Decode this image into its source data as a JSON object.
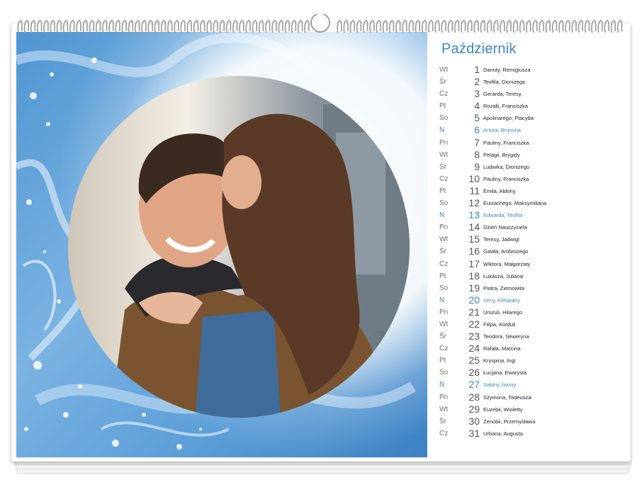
{
  "calendar": {
    "month": "Październik",
    "days": [
      {
        "dow": "Wt",
        "day": "1",
        "names": "Danuty, Remigiusza",
        "sunday": false
      },
      {
        "dow": "Śr",
        "day": "2",
        "names": "Teofila, Dionizego",
        "sunday": false
      },
      {
        "dow": "Cz",
        "day": "3",
        "names": "Gerarda, Teresy",
        "sunday": false
      },
      {
        "dow": "Pt",
        "day": "4",
        "names": "Rozalii, Franciszka",
        "sunday": false
      },
      {
        "dow": "So",
        "day": "5",
        "names": "Apolinarego, Placyda",
        "sunday": false
      },
      {
        "dow": "N",
        "day": "6",
        "names": "Artura, Brunona",
        "sunday": true
      },
      {
        "dow": "Pn",
        "day": "7",
        "names": "Pauliny, Franciszka",
        "sunday": false
      },
      {
        "dow": "Wt",
        "day": "8",
        "names": "Pelagii, Brygidy",
        "sunday": false
      },
      {
        "dow": "Śr",
        "day": "9",
        "names": "Ludwika, Dionizego",
        "sunday": false
      },
      {
        "dow": "Cz",
        "day": "10",
        "names": "Pauliny, Franciszka",
        "sunday": false
      },
      {
        "dow": "Pt",
        "day": "11",
        "names": "Emila, Aldony",
        "sunday": false
      },
      {
        "dow": "So",
        "day": "12",
        "names": "Eustachego, Maksymiliana",
        "sunday": false
      },
      {
        "dow": "N",
        "day": "13",
        "names": "Edwarda, Teofila",
        "sunday": true
      },
      {
        "dow": "Pn",
        "day": "14",
        "names": "Dzień Nauczyciela",
        "sunday": false
      },
      {
        "dow": "Wt",
        "day": "15",
        "names": "Teresy, Jadwigi",
        "sunday": false
      },
      {
        "dow": "Śr",
        "day": "16",
        "names": "Gawła, Ambrożego",
        "sunday": false
      },
      {
        "dow": "Cz",
        "day": "17",
        "names": "Wiktora, Małgorzaty",
        "sunday": false
      },
      {
        "dow": "Pt",
        "day": "18",
        "names": "Łukasza, Juliana",
        "sunday": false
      },
      {
        "dow": "So",
        "day": "19",
        "names": "Piotra, Ziemowita",
        "sunday": false
      },
      {
        "dow": "N",
        "day": "20",
        "names": "Ireny, Kleopatry",
        "sunday": true
      },
      {
        "dow": "Pn",
        "day": "21",
        "names": "Urszuli, Hilarego",
        "sunday": false
      },
      {
        "dow": "Wt",
        "day": "22",
        "names": "Filipa, Korduli",
        "sunday": false
      },
      {
        "dow": "Śr",
        "day": "23",
        "names": "Teodora, Seweryna",
        "sunday": false
      },
      {
        "dow": "Cz",
        "day": "24",
        "names": "Rafała, Marcina",
        "sunday": false
      },
      {
        "dow": "Pt",
        "day": "25",
        "names": "Kryspina, Ingi",
        "sunday": false
      },
      {
        "dow": "So",
        "day": "26",
        "names": "Łucjana, Ewarysta",
        "sunday": false
      },
      {
        "dow": "N",
        "day": "27",
        "names": "Sabiny, Iwony",
        "sunday": true
      },
      {
        "dow": "Pn",
        "day": "28",
        "names": "Szymona, Tadeusza",
        "sunday": false
      },
      {
        "dow": "Wt",
        "day": "29",
        "names": "Euzebii, Wioletty",
        "sunday": false
      },
      {
        "dow": "Śr",
        "day": "30",
        "names": "Zenobii, Przemysława",
        "sunday": false
      },
      {
        "dow": "Cz",
        "day": "31",
        "names": "Urbana, Augusta",
        "sunday": false
      }
    ]
  },
  "colors": {
    "accent": "#3a88c9",
    "marble_blue": "#5a9fd6",
    "binding_wire": "#9a9a9a"
  },
  "icons": {
    "binding": "wire-o-binding-icon",
    "hanger": "hanger-loop-icon"
  }
}
